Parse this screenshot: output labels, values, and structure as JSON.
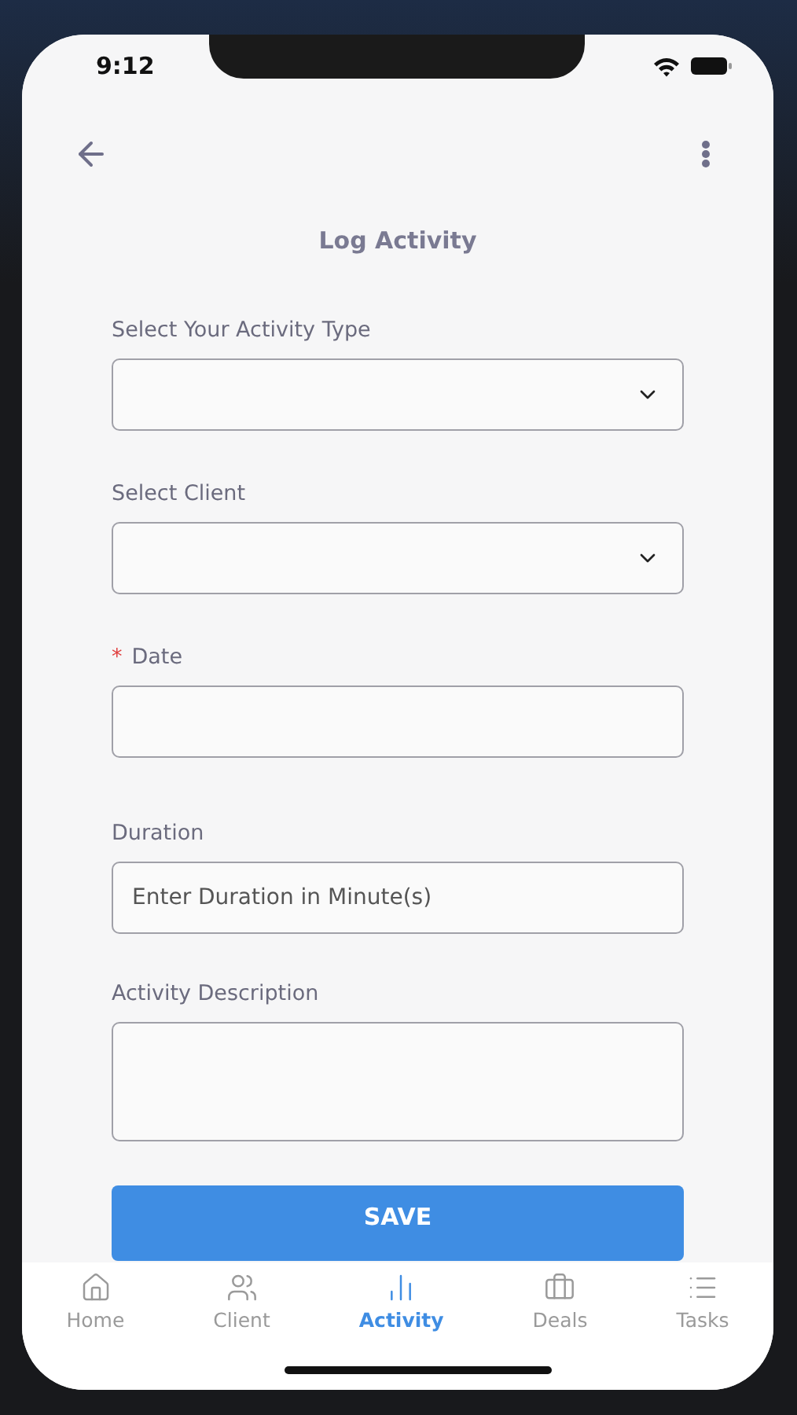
{
  "status_bar": {
    "time": "9:12"
  },
  "header": {
    "title": "Log Activity"
  },
  "fields": [
    {
      "kind": "select",
      "label": "Select Your Activity Type",
      "required": false
    },
    {
      "kind": "select",
      "label": "Select Client",
      "required": false
    },
    {
      "kind": "date",
      "label": "Date",
      "required": true,
      "required_mark": "*"
    },
    {
      "kind": "text",
      "label": "Duration",
      "required": false,
      "placeholder": "Enter Duration in Minute(s)"
    },
    {
      "kind": "textarea",
      "label": "Activity Description",
      "required": false
    }
  ],
  "save_button": "SAVE",
  "tab_bar": [
    {
      "label": "Home",
      "selected": false
    },
    {
      "label": "Client",
      "selected": false
    },
    {
      "label": "Activity",
      "selected": true
    },
    {
      "label": "Deals",
      "selected": false
    },
    {
      "label": "Tasks",
      "selected": false
    }
  ]
}
